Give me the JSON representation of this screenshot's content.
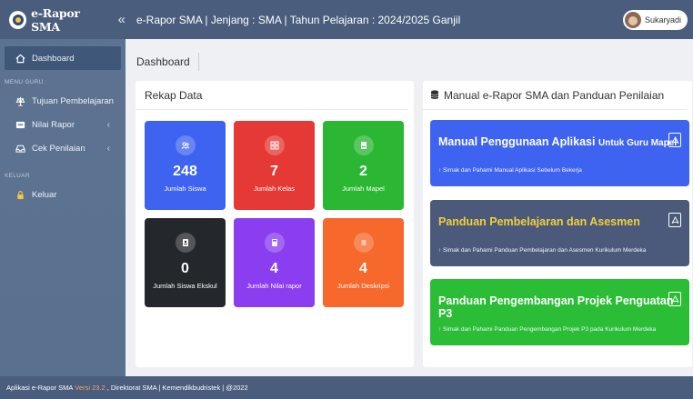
{
  "brand": {
    "title": "e-Rapor SMA",
    "collapse_icon": "double-chevron-left-icon"
  },
  "topbar": {
    "title": "e-Rapor SMA | Jenjang : SMA | Tahun Pelajaran : 2024/2025 Ganjil",
    "user_name": "Sukaryadi"
  },
  "sidebar": {
    "dashboard": "Dashboard",
    "menu_header": "MENU GURU :",
    "items": [
      {
        "label": "Tujuan Pembelajaran",
        "icon": "balance-scale-icon",
        "chevron": ""
      },
      {
        "label": "Nilai Rapor",
        "icon": "inbox-icon",
        "chevron": "‹"
      },
      {
        "label": "Cek Penilaian",
        "icon": "tray-icon",
        "chevron": "‹"
      }
    ],
    "logout_header": "KELUAR",
    "logout": "Keluar"
  },
  "breadcrumb": {
    "title": "Dashboard"
  },
  "rekap": {
    "title": "Rekap Data",
    "tiles": [
      {
        "value": "248",
        "label": "Jumlah Siswa",
        "color": "#3d63f0",
        "icon": "users-icon"
      },
      {
        "value": "7",
        "label": "Jumlah Kelas",
        "color": "#e53935",
        "icon": "grid-icon"
      },
      {
        "value": "2",
        "label": "Jumlah Mapel",
        "color": "#2bb734",
        "icon": "book-icon"
      },
      {
        "value": "0",
        "label": "Jumlah Siswa Ekskul",
        "color": "#24272b",
        "icon": "id-card-icon"
      },
      {
        "value": "4",
        "label": "Jumlah Nilai rapor",
        "color": "#8b3df0",
        "icon": "calculator-icon"
      },
      {
        "value": "4",
        "label": "Jumlah Deskripsi",
        "color": "#f7682c",
        "icon": "list-icon"
      }
    ]
  },
  "manual": {
    "title": "Manual e-Rapor SMA dan Panduan Penilaian",
    "banners": [
      {
        "title": "Manual Penggunaan Aplikasi",
        "title_small": "Untuk Guru Mapel",
        "sub": "↑ Simak dan Pahami Manual Aplikasi Sebelum Bekerja",
        "color": "#3d63f0"
      },
      {
        "title": "Panduan Pembelajaran dan Asesmen",
        "title_small": "",
        "sub": "↑ Simak dan Pahami Panduan Pembelajaran dan Asesmen Kurikulum Merdeka",
        "color": "#4b5a7a"
      },
      {
        "title": "Panduan Pengembangan Projek Penguatan P3",
        "title_small": "",
        "sub": "↑ Simak dan Pahami Panduan Pengembangan Projek P3 pada Kurikulum Merdeka",
        "color": "#2bbd35"
      }
    ]
  },
  "footer": {
    "app": "Aplikasi e-Rapor SMA",
    "version": "Versi 23.2",
    "rest": ", Direktorat SMA | Kemendikbudristek | @2022"
  }
}
